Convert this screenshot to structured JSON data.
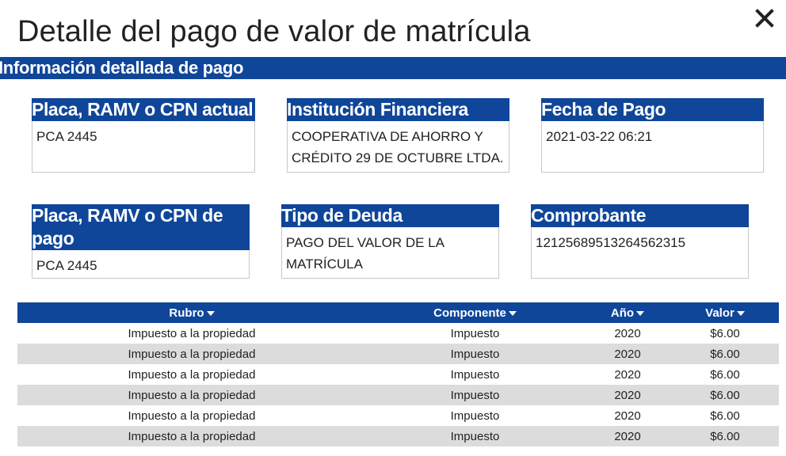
{
  "dialog": {
    "title": "Detalle del pago de valor de matrícula",
    "close_icon": "close-icon"
  },
  "section": {
    "title": "Información detallada de pago"
  },
  "cards": {
    "placa_actual": {
      "label": "Placa, RAMV o CPN actual",
      "value": "PCA 2445"
    },
    "institucion": {
      "label": "Institución Financiera",
      "value": "COOPERATIVA DE AHORRO Y CRÉDITO 29 DE OCTUBRE LTDA."
    },
    "fecha": {
      "label": "Fecha de Pago",
      "value": "2021-03-22 06:21"
    },
    "placa_pago": {
      "label": "Placa, RAMV o CPN de pago",
      "value": "PCA 2445"
    },
    "tipo_deuda": {
      "label": "Tipo de Deuda",
      "value": "PAGO DEL VALOR DE LA MATRÍCULA"
    },
    "comprobante": {
      "label": "Comprobante",
      "value": "12125689513264562315"
    }
  },
  "table": {
    "headers": {
      "rubro": "Rubro",
      "componente": "Componente",
      "anio": "Año",
      "valor": "Valor"
    },
    "rows": [
      {
        "rubro": "Impuesto a la propiedad",
        "componente": "Impuesto",
        "anio": "2020",
        "valor": "$6.00"
      },
      {
        "rubro": "Impuesto a la propiedad",
        "componente": "Impuesto",
        "anio": "2020",
        "valor": "$6.00"
      },
      {
        "rubro": "Impuesto a la propiedad",
        "componente": "Impuesto",
        "anio": "2020",
        "valor": "$6.00"
      },
      {
        "rubro": "Impuesto a la propiedad",
        "componente": "Impuesto",
        "anio": "2020",
        "valor": "$6.00"
      },
      {
        "rubro": "Impuesto a la propiedad",
        "componente": "Impuesto",
        "anio": "2020",
        "valor": "$6.00"
      },
      {
        "rubro": "Impuesto a la propiedad",
        "componente": "Impuesto",
        "anio": "2020",
        "valor": "$6.00"
      }
    ]
  },
  "colors": {
    "accent": "#0f4699",
    "alt_row": "#dcdcdc",
    "border": "#c8c8c8"
  }
}
